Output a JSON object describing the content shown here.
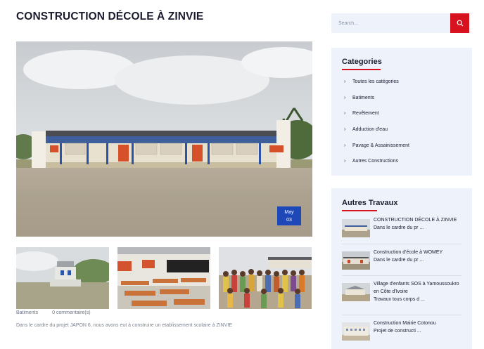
{
  "post": {
    "title": "CONSTRUCTION DÉCOLE À ZINVIE",
    "date_month": "May",
    "date_day": "03",
    "category": "Batiments",
    "comments": "0 commentaire(s)",
    "excerpt": "Dans le cardre du projet JAPON 6, nous avons eut à construire un etablissement scolaire à ZINVIE"
  },
  "search": {
    "placeholder": "Search..."
  },
  "categories": {
    "title": "Categories",
    "items": [
      {
        "label": "Toutes les catégories"
      },
      {
        "label": "Batiments"
      },
      {
        "label": "Revêtement"
      },
      {
        "label": "Adduction d'eau"
      },
      {
        "label": "Pavage & Assainissement"
      },
      {
        "label": "Autres Constructions"
      }
    ]
  },
  "other_works": {
    "title": "Autres Travaux",
    "items": [
      {
        "line1": "CONSTRUCTION DÉCOLE À ZINVIE",
        "line2": "Dans le cardre du pr ..."
      },
      {
        "line1": "Construction d'école à WOMEY",
        "line2": "Dans le cardre du pr ..."
      },
      {
        "line1": "Village d'enfants SOS à Yamoussoukro en Côte d'Ivoire",
        "line2": "Travaux tous corps d ..."
      },
      {
        "line1": "Construction Mairie Cotonou",
        "line2": "Projet de constructi ..."
      }
    ]
  },
  "colors": {
    "accent": "#d7131f",
    "badge": "#1e47b8",
    "panel_bg": "#eef2fb"
  }
}
